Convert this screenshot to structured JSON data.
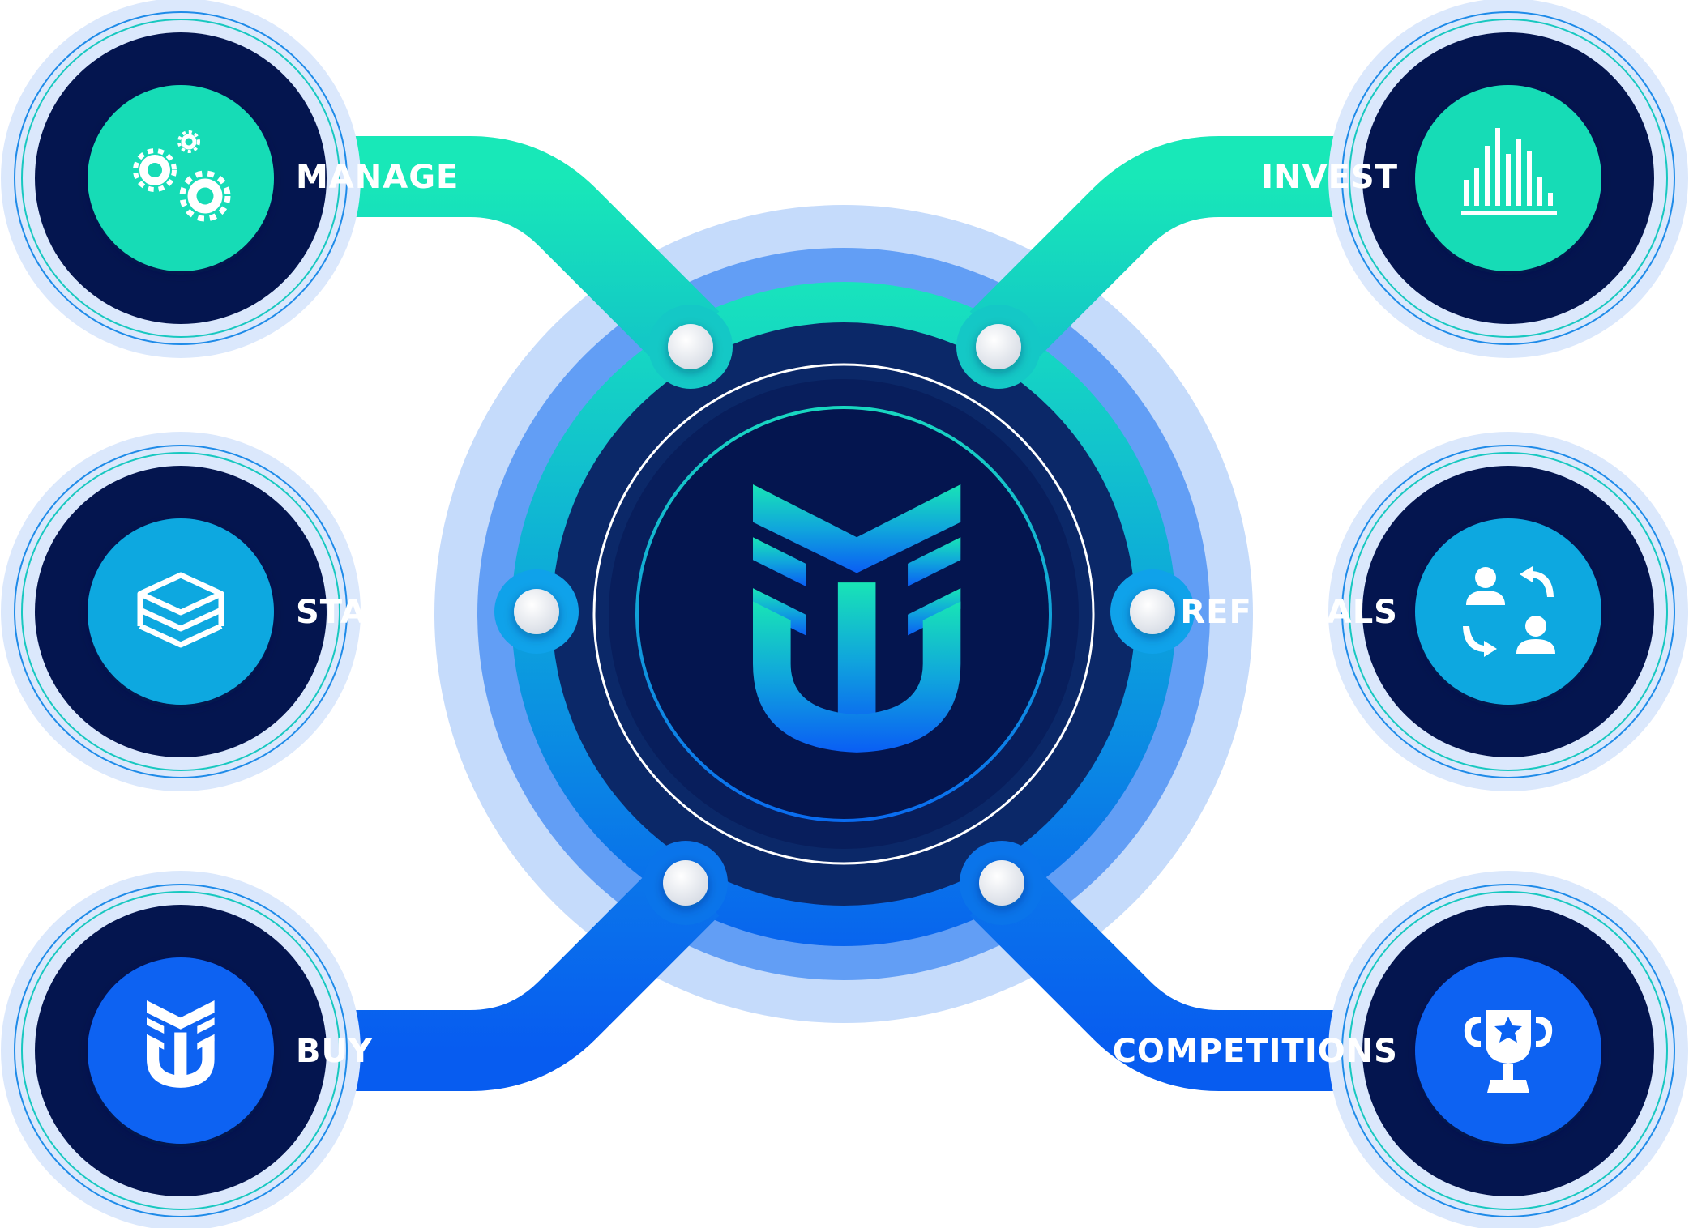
{
  "features": [
    {
      "key": "manage",
      "label": "MANAGE",
      "icon": "gears-icon",
      "color": "#18e8b8"
    },
    {
      "key": "invest",
      "label": "INVEST",
      "icon": "bar-chart-icon",
      "color": "#18e8b8"
    },
    {
      "key": "stake",
      "label": "STAKE",
      "icon": "layers-icon",
      "color": "#12a8ea"
    },
    {
      "key": "referrals",
      "label": "REFERRALS",
      "icon": "referral-exchange-icon",
      "color": "#12a8ea"
    },
    {
      "key": "buy",
      "label": "BUY",
      "icon": "token-logo-icon",
      "color": "#0a62f2"
    },
    {
      "key": "competitions",
      "label": "COMPETITIONS",
      "icon": "trophy-icon",
      "color": "#0a62f2"
    }
  ],
  "colors": {
    "navy": "#04154f",
    "teal": "#18e8b8",
    "cyan": "#12a8ea",
    "blue": "#0a62f2",
    "halo": "#c5dbfb"
  }
}
